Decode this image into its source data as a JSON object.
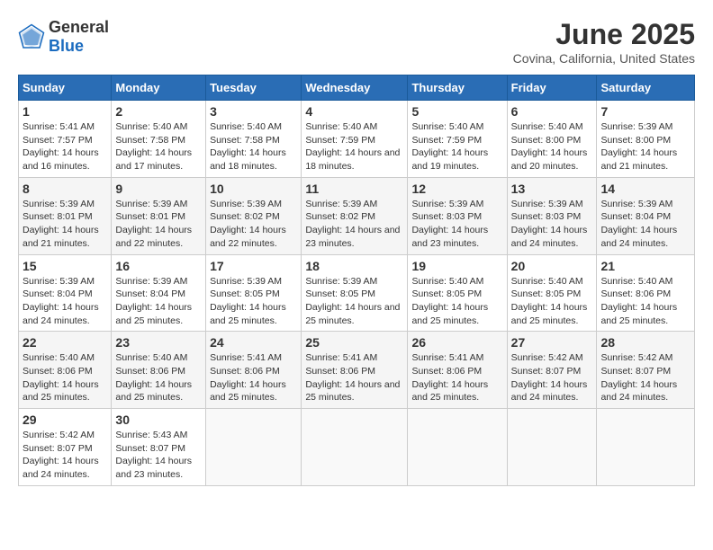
{
  "app": {
    "name_general": "General",
    "name_blue": "Blue"
  },
  "calendar": {
    "month": "June 2025",
    "location": "Covina, California, United States",
    "headers": [
      "Sunday",
      "Monday",
      "Tuesday",
      "Wednesday",
      "Thursday",
      "Friday",
      "Saturday"
    ],
    "weeks": [
      [
        null,
        {
          "day": "2",
          "sunrise": "5:40 AM",
          "sunset": "7:58 PM",
          "daylight": "14 hours and 17 minutes."
        },
        {
          "day": "3",
          "sunrise": "5:40 AM",
          "sunset": "7:58 PM",
          "daylight": "14 hours and 18 minutes."
        },
        {
          "day": "4",
          "sunrise": "5:40 AM",
          "sunset": "7:59 PM",
          "daylight": "14 hours and 18 minutes."
        },
        {
          "day": "5",
          "sunrise": "5:40 AM",
          "sunset": "7:59 PM",
          "daylight": "14 hours and 19 minutes."
        },
        {
          "day": "6",
          "sunrise": "5:40 AM",
          "sunset": "8:00 PM",
          "daylight": "14 hours and 20 minutes."
        },
        {
          "day": "7",
          "sunrise": "5:39 AM",
          "sunset": "8:00 PM",
          "daylight": "14 hours and 21 minutes."
        }
      ],
      [
        {
          "day": "1",
          "sunrise": "5:41 AM",
          "sunset": "7:57 PM",
          "daylight": "14 hours and 16 minutes."
        },
        null,
        null,
        null,
        null,
        null,
        null
      ],
      [
        {
          "day": "8",
          "sunrise": "5:39 AM",
          "sunset": "8:01 PM",
          "daylight": "14 hours and 21 minutes."
        },
        {
          "day": "9",
          "sunrise": "5:39 AM",
          "sunset": "8:01 PM",
          "daylight": "14 hours and 22 minutes."
        },
        {
          "day": "10",
          "sunrise": "5:39 AM",
          "sunset": "8:02 PM",
          "daylight": "14 hours and 22 minutes."
        },
        {
          "day": "11",
          "sunrise": "5:39 AM",
          "sunset": "8:02 PM",
          "daylight": "14 hours and 23 minutes."
        },
        {
          "day": "12",
          "sunrise": "5:39 AM",
          "sunset": "8:03 PM",
          "daylight": "14 hours and 23 minutes."
        },
        {
          "day": "13",
          "sunrise": "5:39 AM",
          "sunset": "8:03 PM",
          "daylight": "14 hours and 24 minutes."
        },
        {
          "day": "14",
          "sunrise": "5:39 AM",
          "sunset": "8:04 PM",
          "daylight": "14 hours and 24 minutes."
        }
      ],
      [
        {
          "day": "15",
          "sunrise": "5:39 AM",
          "sunset": "8:04 PM",
          "daylight": "14 hours and 24 minutes."
        },
        {
          "day": "16",
          "sunrise": "5:39 AM",
          "sunset": "8:04 PM",
          "daylight": "14 hours and 25 minutes."
        },
        {
          "day": "17",
          "sunrise": "5:39 AM",
          "sunset": "8:05 PM",
          "daylight": "14 hours and 25 minutes."
        },
        {
          "day": "18",
          "sunrise": "5:39 AM",
          "sunset": "8:05 PM",
          "daylight": "14 hours and 25 minutes."
        },
        {
          "day": "19",
          "sunrise": "5:40 AM",
          "sunset": "8:05 PM",
          "daylight": "14 hours and 25 minutes."
        },
        {
          "day": "20",
          "sunrise": "5:40 AM",
          "sunset": "8:05 PM",
          "daylight": "14 hours and 25 minutes."
        },
        {
          "day": "21",
          "sunrise": "5:40 AM",
          "sunset": "8:06 PM",
          "daylight": "14 hours and 25 minutes."
        }
      ],
      [
        {
          "day": "22",
          "sunrise": "5:40 AM",
          "sunset": "8:06 PM",
          "daylight": "14 hours and 25 minutes."
        },
        {
          "day": "23",
          "sunrise": "5:40 AM",
          "sunset": "8:06 PM",
          "daylight": "14 hours and 25 minutes."
        },
        {
          "day": "24",
          "sunrise": "5:41 AM",
          "sunset": "8:06 PM",
          "daylight": "14 hours and 25 minutes."
        },
        {
          "day": "25",
          "sunrise": "5:41 AM",
          "sunset": "8:06 PM",
          "daylight": "14 hours and 25 minutes."
        },
        {
          "day": "26",
          "sunrise": "5:41 AM",
          "sunset": "8:06 PM",
          "daylight": "14 hours and 25 minutes."
        },
        {
          "day": "27",
          "sunrise": "5:42 AM",
          "sunset": "8:07 PM",
          "daylight": "14 hours and 24 minutes."
        },
        {
          "day": "28",
          "sunrise": "5:42 AM",
          "sunset": "8:07 PM",
          "daylight": "14 hours and 24 minutes."
        }
      ],
      [
        {
          "day": "29",
          "sunrise": "5:42 AM",
          "sunset": "8:07 PM",
          "daylight": "14 hours and 24 minutes."
        },
        {
          "day": "30",
          "sunrise": "5:43 AM",
          "sunset": "8:07 PM",
          "daylight": "14 hours and 23 minutes."
        },
        null,
        null,
        null,
        null,
        null
      ]
    ],
    "daylight_label": "Daylight hours",
    "sunrise_label": "Sunrise:",
    "sunset_label": "Sunset:"
  }
}
